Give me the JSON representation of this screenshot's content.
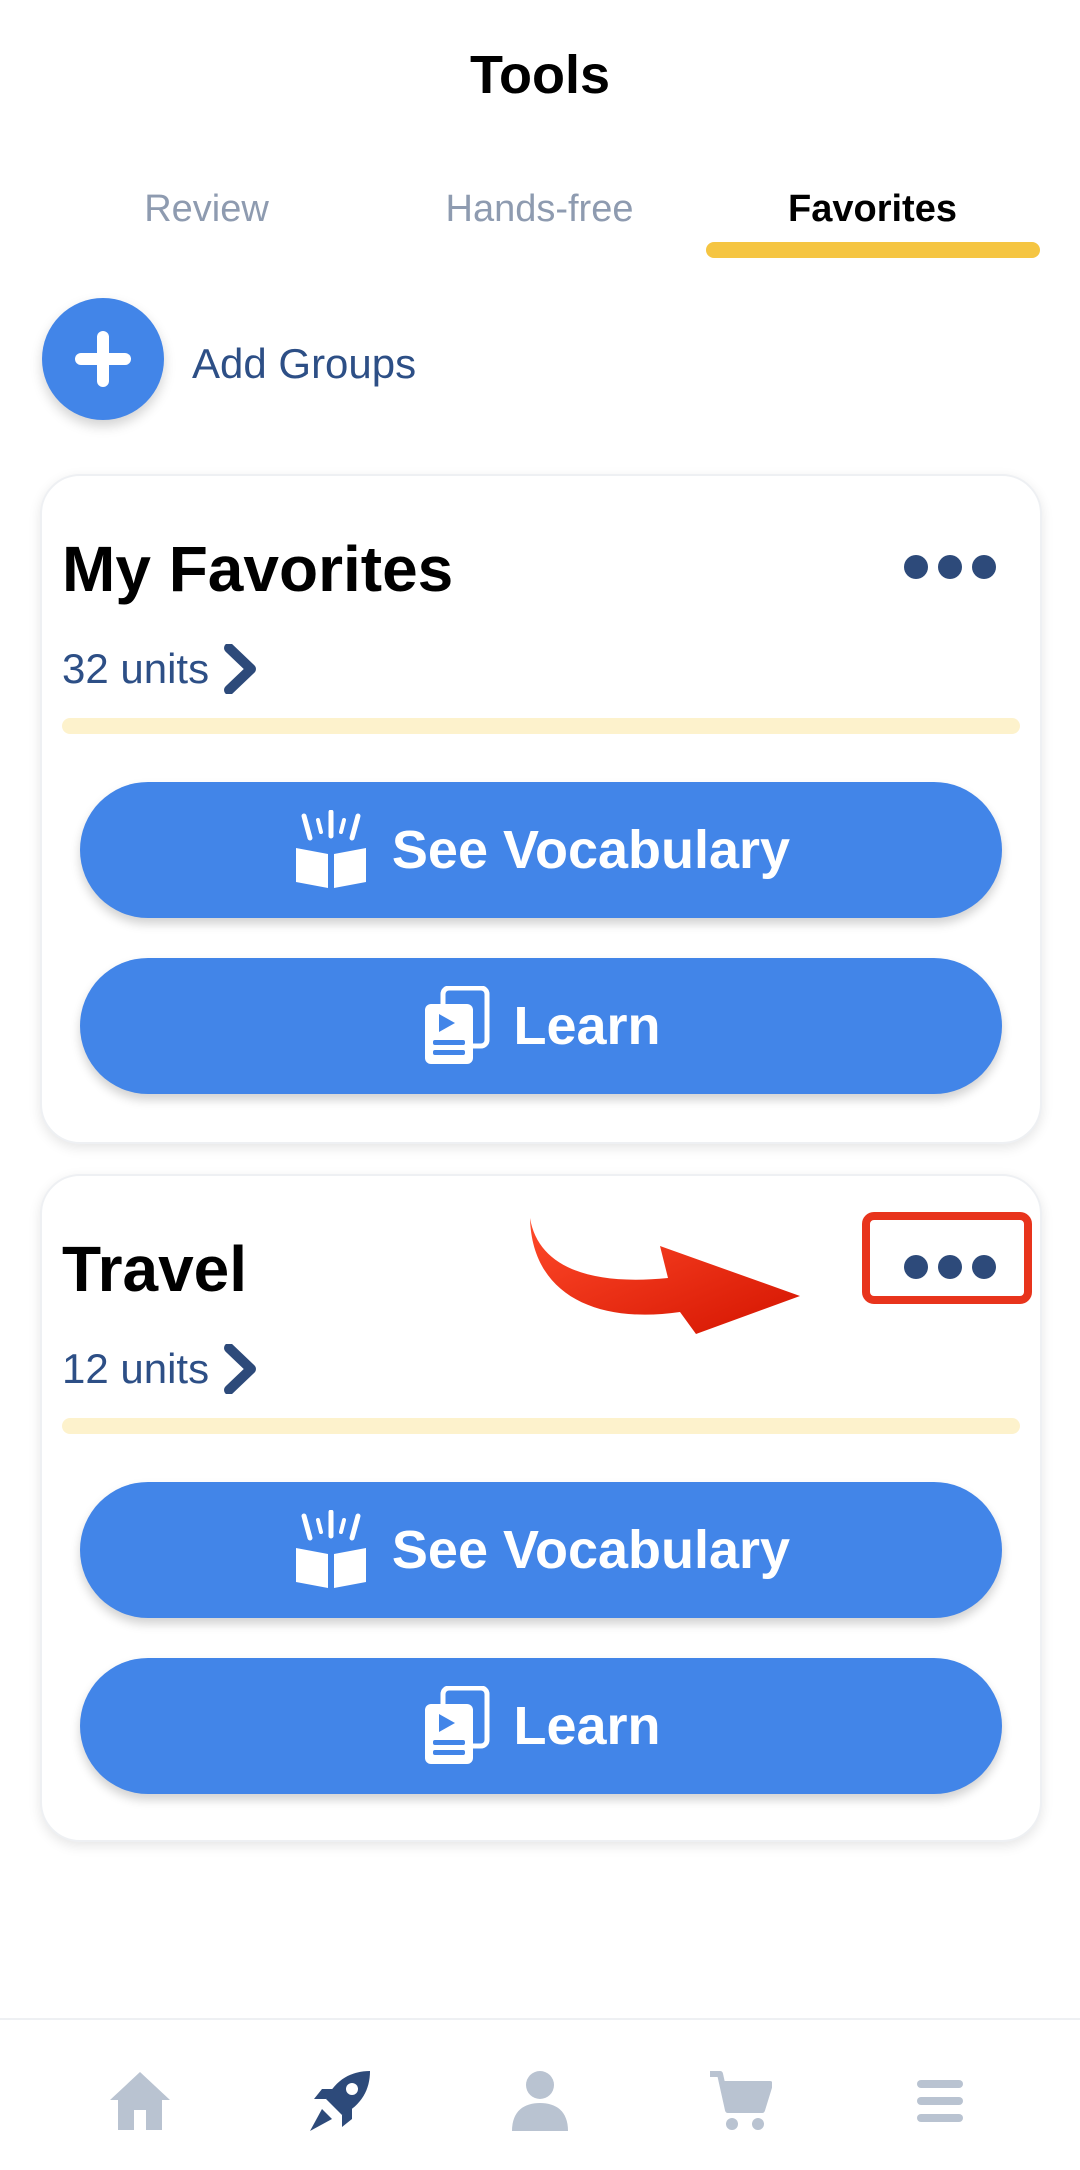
{
  "header": {
    "title": "Tools"
  },
  "tabs": [
    {
      "label": "Review",
      "active": false
    },
    {
      "label": "Hands-free",
      "active": false
    },
    {
      "label": "Favorites",
      "active": true
    }
  ],
  "add_groups": {
    "label": "Add Groups",
    "icon": "plus-icon"
  },
  "groups": [
    {
      "title": "My Favorites",
      "units": "32 units",
      "progress": 0,
      "see_vocabulary_label": "See Vocabulary",
      "learn_label": "Learn"
    },
    {
      "title": "Travel",
      "units": "12 units",
      "progress": 0,
      "see_vocabulary_label": "See Vocabulary",
      "learn_label": "Learn"
    }
  ],
  "bottom_nav": [
    {
      "icon": "home-icon",
      "active": false
    },
    {
      "icon": "rocket-icon",
      "active": true
    },
    {
      "icon": "profile-icon",
      "active": false
    },
    {
      "icon": "cart-icon",
      "active": false
    },
    {
      "icon": "menu-icon",
      "active": false
    }
  ],
  "colors": {
    "accent": "#4285e8",
    "tab_indicator": "#f5c542",
    "progress_track": "#fdf2cc",
    "dark_blue": "#2d4a7a",
    "nav_inactive": "#b9c3d1",
    "annotation": "#e8341c"
  }
}
